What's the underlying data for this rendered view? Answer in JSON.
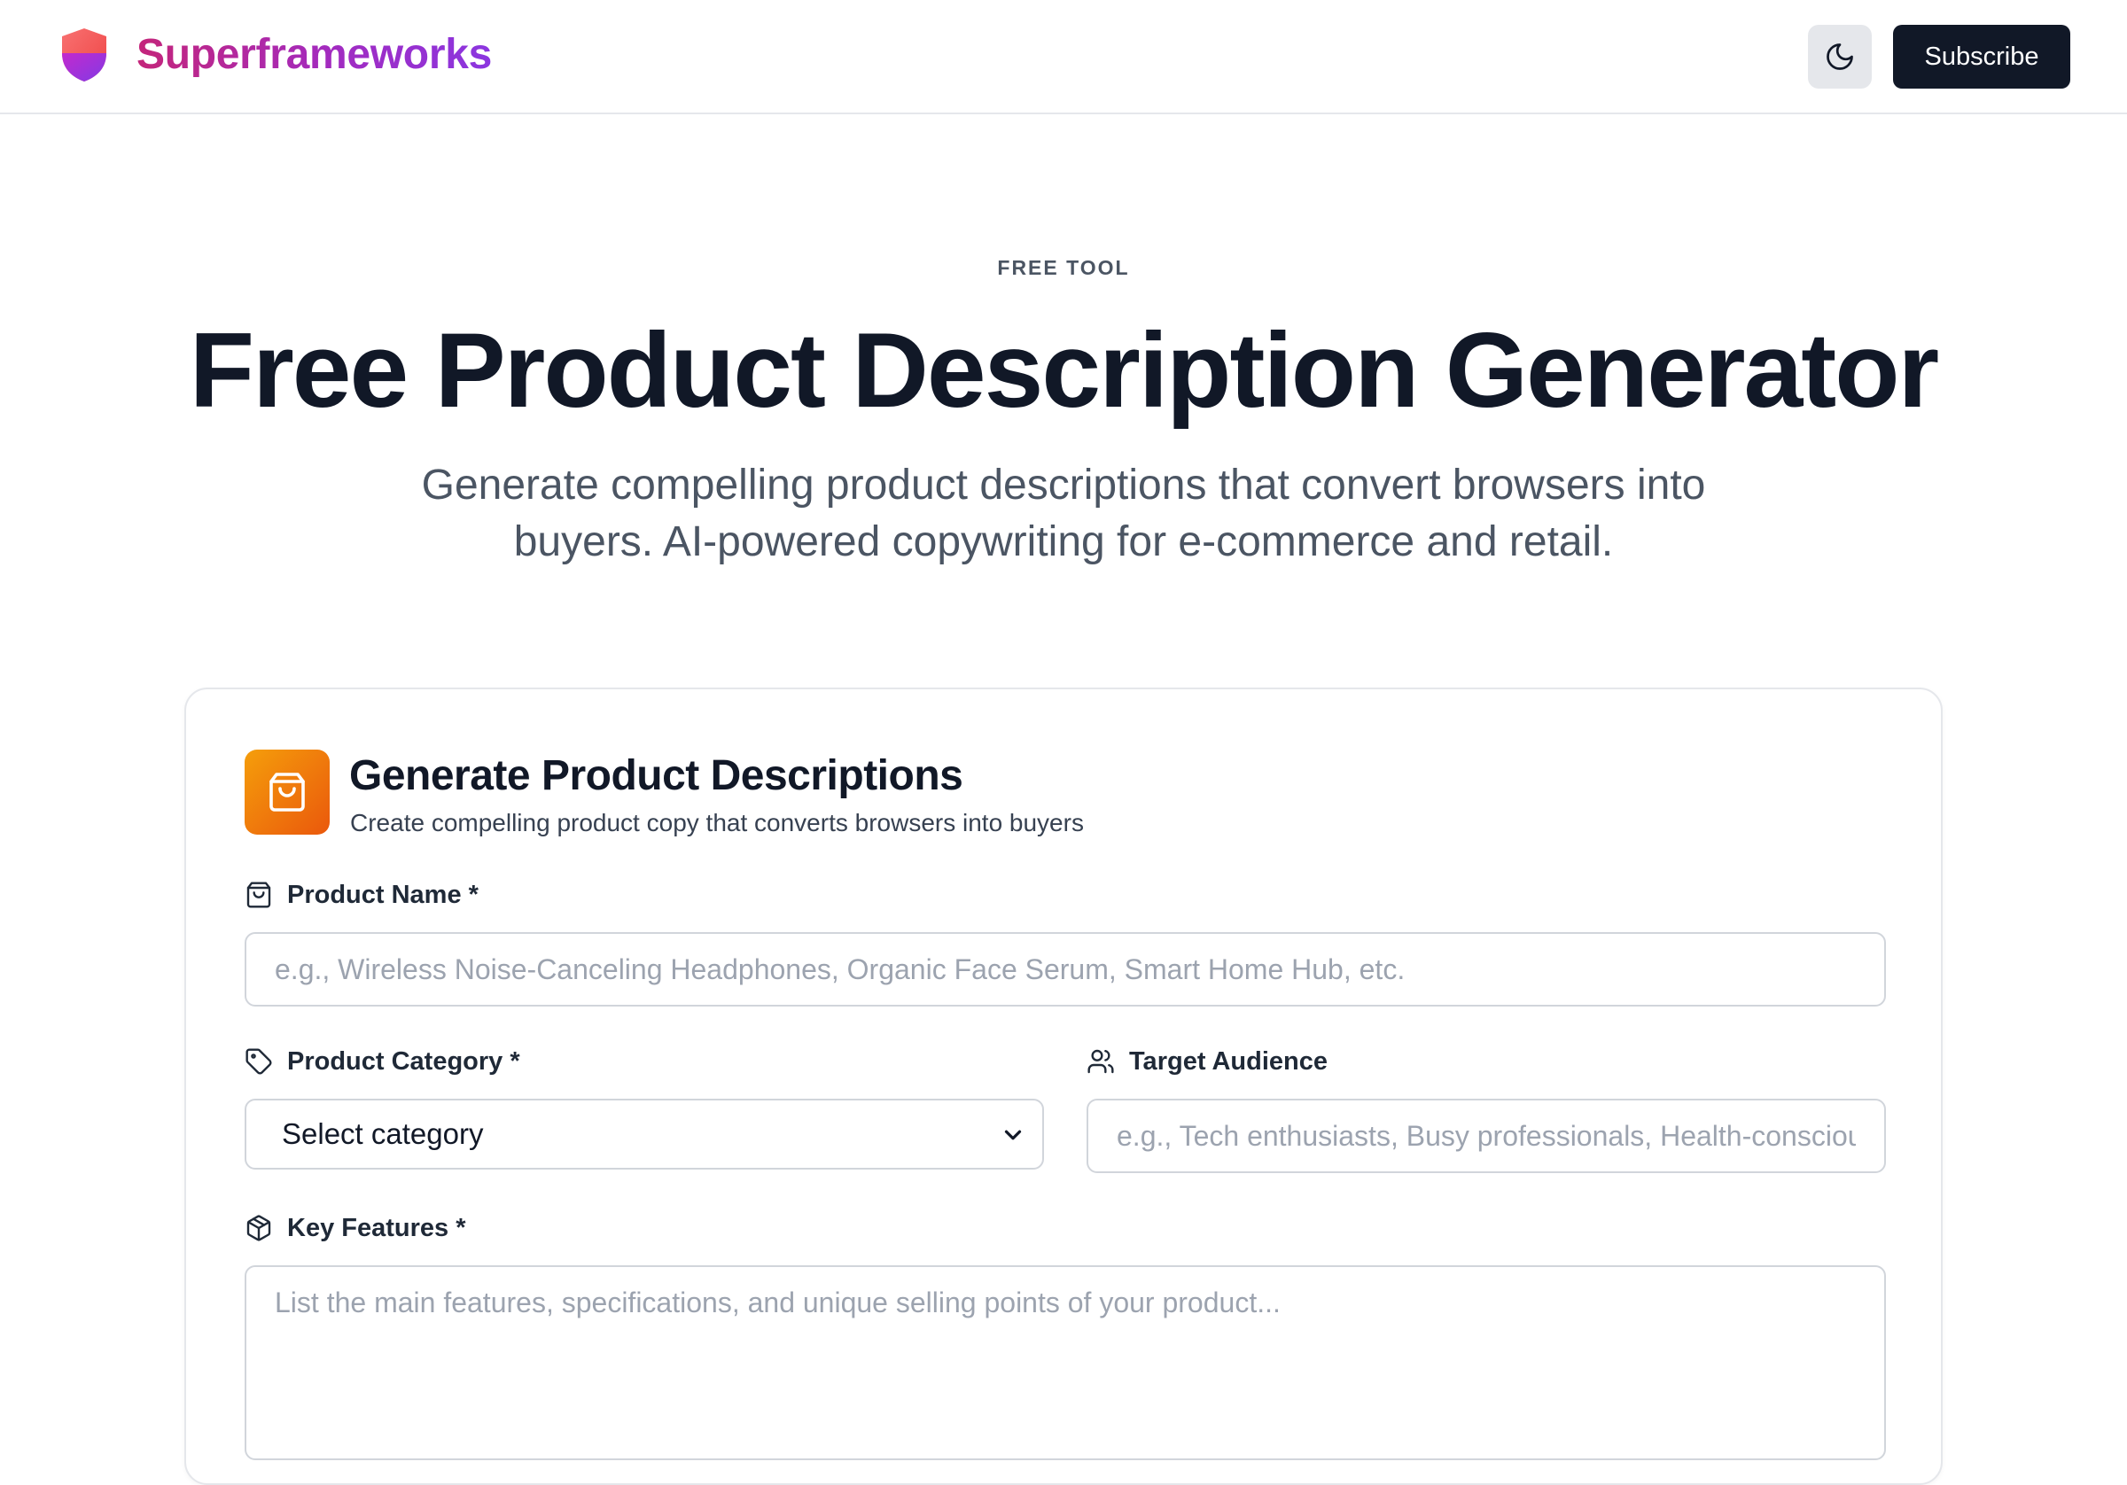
{
  "header": {
    "brand_name": "Superframeworks",
    "logo_icon": "shield-logo-icon",
    "theme_toggle_icon": "moon-icon",
    "subscribe_label": "Subscribe"
  },
  "hero": {
    "eyebrow": "FREE TOOL",
    "title": "Free Product Description Generator",
    "subtitle": "Generate compelling product descriptions that convert browsers into buyers. AI-powered copywriting for e-commerce and retail."
  },
  "card": {
    "icon": "shopping-bag-icon",
    "title": "Generate Product Descriptions",
    "subtitle": "Create compelling product copy that converts browsers into buyers",
    "fields": {
      "product_name": {
        "label": "Product Name *",
        "icon": "shopping-bag-icon",
        "value": "",
        "placeholder": "e.g., Wireless Noise-Canceling Headphones, Organic Face Serum, Smart Home Hub, etc."
      },
      "product_category": {
        "label": "Product Category *",
        "icon": "tag-icon",
        "selected": "Select category"
      },
      "target_audience": {
        "label": "Target Audience",
        "icon": "users-icon",
        "value": "",
        "placeholder": "e.g., Tech enthusiasts, Busy professionals, Health-conscious consumers"
      },
      "key_features": {
        "label": "Key Features *",
        "icon": "package-icon",
        "value": "",
        "placeholder": "List the main features, specifications, and unique selling points of your product..."
      }
    }
  },
  "colors": {
    "brand_gradient_start": "#c4257a",
    "brand_gradient_end": "#8b36e0",
    "primary_button": "#111827",
    "card_icon_gradient_start": "#f59e0b",
    "card_icon_gradient_end": "#ea580c"
  }
}
